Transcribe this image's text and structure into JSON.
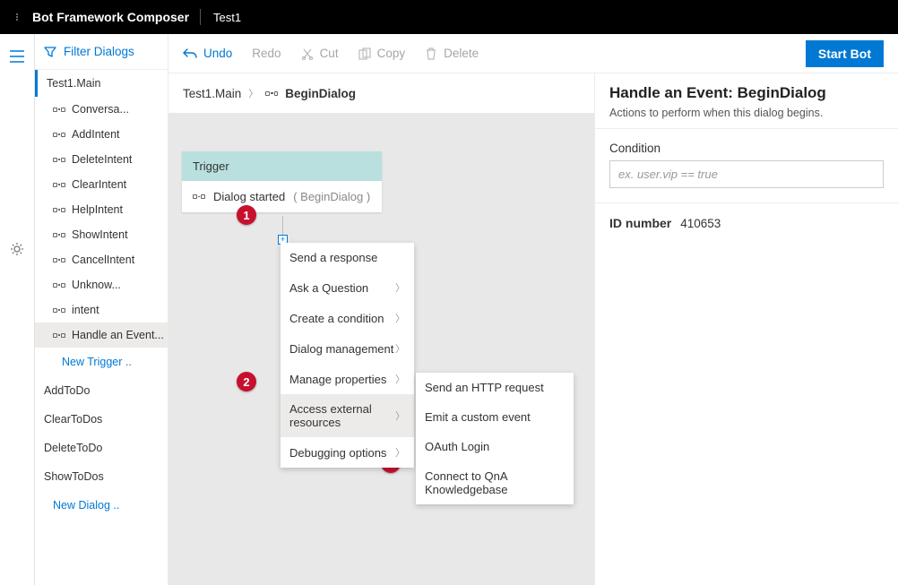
{
  "titlebar": {
    "app": "Bot Framework Composer",
    "project": "Test1"
  },
  "sidebar": {
    "filter_label": "Filter Dialogs",
    "root": "Test1.Main",
    "items": [
      {
        "label": "Conversa..."
      },
      {
        "label": "AddIntent"
      },
      {
        "label": "DeleteIntent"
      },
      {
        "label": "ClearIntent"
      },
      {
        "label": "HelpIntent"
      },
      {
        "label": "ShowIntent"
      },
      {
        "label": "CancelIntent"
      },
      {
        "label": "Unknow..."
      },
      {
        "label": "intent"
      },
      {
        "label": "Handle an Event..."
      }
    ],
    "new_trigger": "New Trigger ..",
    "dialogs": [
      "AddToDo",
      "ClearToDos",
      "DeleteToDo",
      "ShowToDos"
    ],
    "new_dialog": "New Dialog .."
  },
  "toolbar": {
    "undo": "Undo",
    "redo": "Redo",
    "cut": "Cut",
    "copy": "Copy",
    "delete": "Delete",
    "start": "Start Bot"
  },
  "breadcrumb": {
    "root": "Test1.Main",
    "leaf": "BeginDialog"
  },
  "trigger": {
    "head": "Trigger",
    "body_pre": "Dialog started",
    "body_paren": "( BeginDialog )"
  },
  "callouts": {
    "c1": "1",
    "c2": "2",
    "c3": "3"
  },
  "menu": {
    "items": [
      {
        "label": "Send a response",
        "sub": false
      },
      {
        "label": "Ask a Question",
        "sub": true
      },
      {
        "label": "Create a condition",
        "sub": true
      },
      {
        "label": "Dialog management",
        "sub": true
      },
      {
        "label": "Manage properties",
        "sub": true
      },
      {
        "label": "Access external resources",
        "sub": true,
        "hover": true
      },
      {
        "label": "Debugging options",
        "sub": true
      }
    ]
  },
  "submenu": {
    "items": [
      {
        "label": "Send an HTTP request"
      },
      {
        "label": "Emit a custom event"
      },
      {
        "label": "OAuth Login"
      },
      {
        "label": "Connect to QnA Knowledgebase"
      }
    ]
  },
  "inspector": {
    "title": "Handle an Event: BeginDialog",
    "subtitle": "Actions to perform when this dialog begins.",
    "condition_label": "Condition",
    "condition_placeholder": "ex. user.vip == true",
    "id_label": "ID number",
    "id_value": "410653"
  }
}
